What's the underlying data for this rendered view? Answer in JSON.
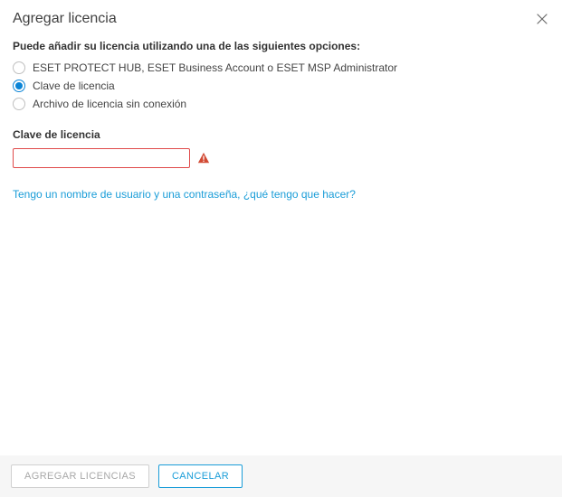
{
  "header": {
    "title": "Agregar licencia"
  },
  "prompt": "Puede añadir su licencia utilizando una de las siguientes opciones:",
  "options": [
    {
      "label": "ESET PROTECT HUB, ESET Business Account o ESET MSP Administrator",
      "selected": false
    },
    {
      "label": "Clave de licencia",
      "selected": true
    },
    {
      "label": "Archivo de licencia sin conexión",
      "selected": false
    }
  ],
  "section": {
    "label": "Clave de licencia",
    "input_value": ""
  },
  "link": {
    "text": "Tengo un nombre de usuario y una contraseña, ¿qué tengo que hacer?"
  },
  "footer": {
    "add": "AGREGAR LICENCIAS",
    "cancel": "CANCELAR"
  }
}
